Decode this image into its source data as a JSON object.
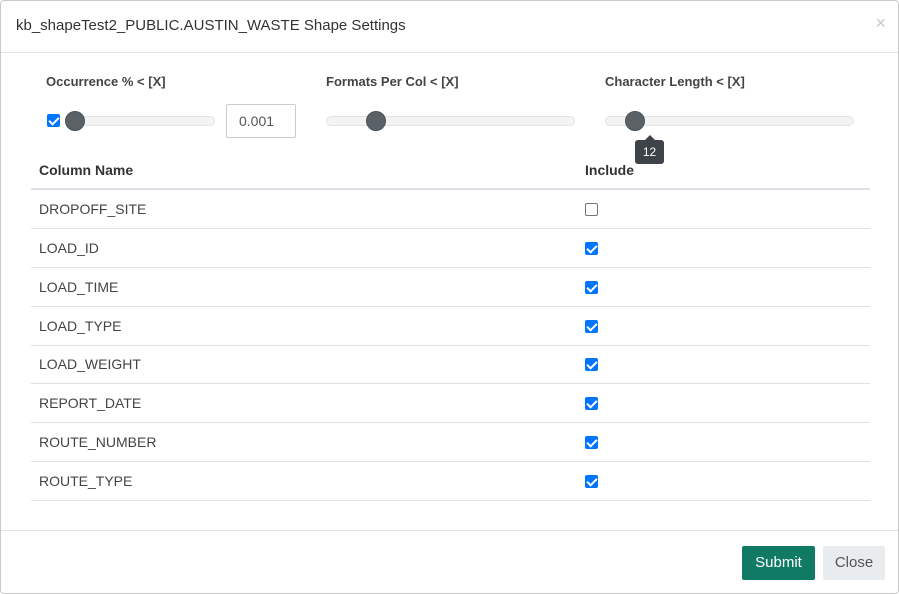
{
  "modal": {
    "title": "kb_shapeTest2_PUBLIC.AUSTIN_WASTE Shape Settings",
    "close_glyph": "×"
  },
  "sliders": {
    "occurrence": {
      "label": "Occurrence % < [X]",
      "enabled": true,
      "value": "0.001",
      "level": 0.0
    },
    "formats": {
      "label": "Formats Per Col < [X]",
      "level": 0.2
    },
    "char_length": {
      "label": "Character Length < [X]",
      "tooltip": "12",
      "level": 0.12
    }
  },
  "table": {
    "headers": {
      "column_name": "Column Name",
      "include": "Include"
    },
    "rows": [
      {
        "name": "DROPOFF_SITE",
        "include": false
      },
      {
        "name": "LOAD_ID",
        "include": true
      },
      {
        "name": "LOAD_TIME",
        "include": true
      },
      {
        "name": "LOAD_TYPE",
        "include": true
      },
      {
        "name": "LOAD_WEIGHT",
        "include": true
      },
      {
        "name": "REPORT_DATE",
        "include": true
      },
      {
        "name": "ROUTE_NUMBER",
        "include": true
      },
      {
        "name": "ROUTE_TYPE",
        "include": true
      }
    ]
  },
  "footer": {
    "submit_label": "Submit",
    "close_label": "Close"
  },
  "colors": {
    "submit": "#117a65",
    "checkbox": "#0075ff",
    "thumb": "#5a6268"
  }
}
